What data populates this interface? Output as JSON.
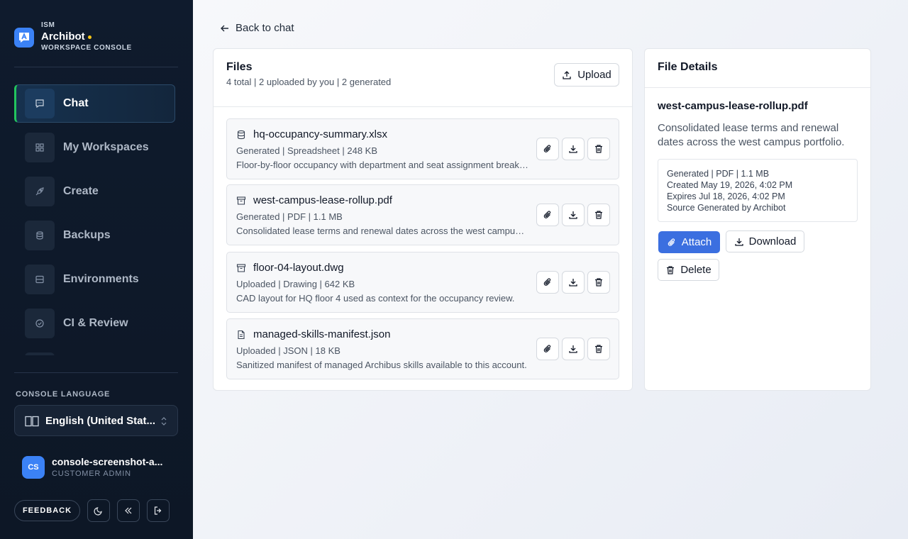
{
  "brand": {
    "ism": "ISM",
    "name": "Archibot",
    "subtitle": "WORKSPACE CONSOLE"
  },
  "nav": {
    "items": [
      {
        "label": "Chat",
        "icon": "chat-icon",
        "active": true
      },
      {
        "label": "My Workspaces",
        "icon": "grid-icon"
      },
      {
        "label": "Create",
        "icon": "rocket-icon"
      },
      {
        "label": "Backups",
        "icon": "database-icon"
      },
      {
        "label": "Environments",
        "icon": "server-icon"
      },
      {
        "label": "CI & Review",
        "icon": "check-circle-icon"
      }
    ]
  },
  "language": {
    "title": "CONSOLE LANGUAGE",
    "value": "English (United Stat..."
  },
  "user": {
    "initials": "CS",
    "name": "console-screenshot-a...",
    "role": "CUSTOMER ADMIN"
  },
  "footer": {
    "feedback_label": "FEEDBACK"
  },
  "back_label": "Back to chat",
  "files": {
    "title": "Files",
    "meta": "4 total | 2 uploaded by you | 2 generated",
    "upload_label": "Upload",
    "rows": [
      {
        "name": "hq-occupancy-summary.xlsx",
        "meta": "Generated | Spreadsheet | 248 KB",
        "description": "Floor-by-floor occupancy with department and seat assignment breakdowns.",
        "icon": "database-icon"
      },
      {
        "name": "west-campus-lease-rollup.pdf",
        "meta": "Generated | PDF | 1.1 MB",
        "description": "Consolidated lease terms and renewal dates across the west campus portfolio.",
        "icon": "archive-icon"
      },
      {
        "name": "floor-04-layout.dwg",
        "meta": "Uploaded | Drawing | 642 KB",
        "description": "CAD layout for HQ floor 4 used as context for the occupancy review.",
        "icon": "archive-icon"
      },
      {
        "name": "managed-skills-manifest.json",
        "meta": "Uploaded | JSON | 18 KB",
        "description": "Sanitized manifest of managed Archibus skills available to this account.",
        "icon": "document-icon"
      }
    ]
  },
  "details": {
    "title": "File Details",
    "name": "west-campus-lease-rollup.pdf",
    "description": "Consolidated lease terms and renewal dates across the west campus portfolio.",
    "info": {
      "type": "Generated | PDF | 1.1 MB",
      "created": "Created May 19, 2026, 4:02 PM",
      "expires": "Expires Jul 18, 2026, 4:02 PM",
      "source": "Source Generated by Archibot"
    },
    "attach_label": "Attach",
    "download_label": "Download",
    "delete_label": "Delete"
  },
  "colors": {
    "sidebar_bg": "#0f1b2d",
    "accent_blue": "#3b6fe0",
    "active_marker": "#22c55e",
    "brand_dot": "#f5c518"
  }
}
